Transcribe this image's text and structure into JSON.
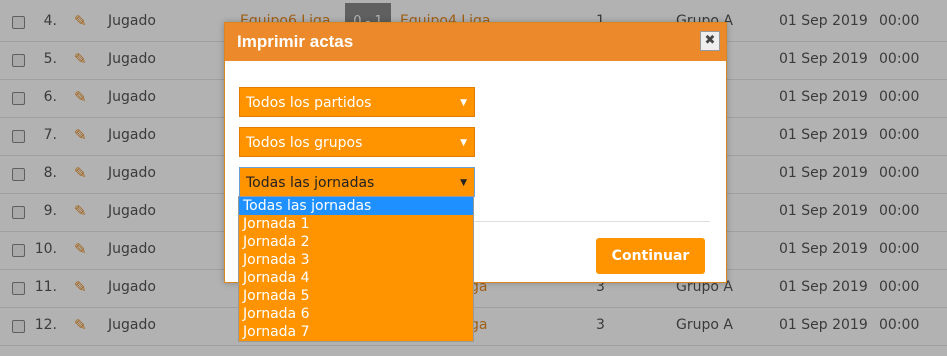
{
  "table": {
    "rows": [
      {
        "num": "4.",
        "status": "Jugado",
        "team1": "Equipo6 Liga",
        "score": "0 - 1",
        "team2": "Equipo4 Liga",
        "jornada": "1",
        "group": "Grupo A",
        "date": "01 Sep 2019",
        "time": "00:00"
      },
      {
        "num": "5.",
        "status": "Jugado",
        "team1": "",
        "score": "",
        "team2": "",
        "jornada": "",
        "group": "",
        "date": "01 Sep 2019",
        "time": "00:00"
      },
      {
        "num": "6.",
        "status": "Jugado",
        "team1": "",
        "score": "",
        "team2": "",
        "jornada": "",
        "group": "",
        "date": "01 Sep 2019",
        "time": "00:00"
      },
      {
        "num": "7.",
        "status": "Jugado",
        "team1": "",
        "score": "",
        "team2": "",
        "jornada": "",
        "group": "",
        "date": "01 Sep 2019",
        "time": "00:00"
      },
      {
        "num": "8.",
        "status": "Jugado",
        "team1": "",
        "score": "",
        "team2": "",
        "jornada": "",
        "group": "",
        "date": "01 Sep 2019",
        "time": "00:00"
      },
      {
        "num": "9.",
        "status": "Jugado",
        "team1": "",
        "score": "",
        "team2": "",
        "jornada": "",
        "group": "",
        "date": "01 Sep 2019",
        "time": "00:00"
      },
      {
        "num": "10.",
        "status": "Jugado",
        "team1": "",
        "score": "",
        "team2": "",
        "jornada": "",
        "group": "",
        "date": "01 Sep 2019",
        "time": "00:00"
      },
      {
        "num": "11.",
        "status": "Jugado",
        "team1": "",
        "score": "",
        "team2": "ga",
        "jornada": "3",
        "group": "Grupo A",
        "date": "01 Sep 2019",
        "time": "00:00"
      },
      {
        "num": "12.",
        "status": "Jugado",
        "team1": "",
        "score": "",
        "team2": "ga",
        "jornada": "3",
        "group": "Grupo A",
        "date": "01 Sep 2019",
        "time": "00:00"
      }
    ],
    "edit_icon": "pencil-icon"
  },
  "modal": {
    "title": "Imprimir actas",
    "close_label": "✖",
    "select_partidos": "Todos los partidos",
    "select_grupos": "Todos los grupos",
    "select_jornadas": "Todas las jornadas",
    "arrow_glyph": "▼",
    "continue_label": "Continuar",
    "dropdown_options": [
      "Todas las jornadas",
      "Jornada 1",
      "Jornada 2",
      "Jornada 3",
      "Jornada 4",
      "Jornada 5",
      "Jornada 6",
      "Jornada 7"
    ]
  },
  "colors": {
    "accent": "#ff9300",
    "header": "#ec8a2b",
    "selected_option": "#1e90ff"
  }
}
